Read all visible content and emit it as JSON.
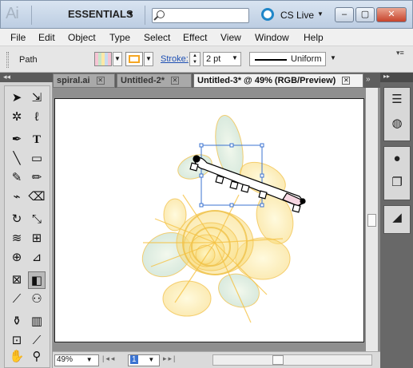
{
  "titlebar": {
    "app_logo": "Ai",
    "workspace": "ESSENTIALS",
    "search_placeholder": "",
    "cslive_label": "CS Live",
    "buttons": {
      "minimize": "–",
      "maximize": "▢",
      "close": "✕"
    }
  },
  "menubar": {
    "items": [
      "File",
      "Edit",
      "Object",
      "Type",
      "Select",
      "Effect",
      "View",
      "Window",
      "Help"
    ]
  },
  "controlbar": {
    "selection_type": "Path",
    "stroke_label": "Stroke:",
    "stroke_weight": "2 pt",
    "profile_label": "Uniform",
    "fill_color": "gradient-pastel",
    "stroke_color": "#f5a623"
  },
  "tabs": [
    {
      "label": "spiral.ai",
      "active": false
    },
    {
      "label": "Untitled-2*",
      "active": false
    },
    {
      "label": "Untitled-3* @ 49% (RGB/Preview)",
      "active": true
    }
  ],
  "tools": [
    [
      "selection-arrow-icon",
      "direct-selection-icon"
    ],
    [
      "magic-wand-icon",
      "lasso-icon"
    ],
    [
      "pen-icon",
      "type-icon"
    ],
    [
      "line-segment-icon",
      "rectangle-icon"
    ],
    [
      "paintbrush-icon",
      "pencil-icon"
    ],
    [
      "blob-brush-icon",
      "eraser-icon"
    ],
    [
      "rotate-icon",
      "scale-icon"
    ],
    [
      "warp-icon",
      "free-transform-icon"
    ],
    [
      "shape-builder-icon",
      "perspective-grid-icon"
    ],
    [
      "mesh-icon",
      "gradient-icon"
    ],
    [
      "eyedropper-icon",
      "blend-icon"
    ],
    [
      "symbol-sprayer-icon",
      "column-graph-icon"
    ],
    [
      "artboard-icon",
      "slice-icon"
    ],
    [
      "hand-icon",
      "zoom-icon"
    ]
  ],
  "statusbar": {
    "zoom": "49%",
    "page": "1"
  },
  "dock": [
    "color-panel-icon",
    "swatches-panel-icon",
    "brushes-panel-icon",
    "symbols-panel-icon",
    "stroke-panel-icon",
    "gradient-panel-icon",
    "transparency-panel-icon"
  ]
}
